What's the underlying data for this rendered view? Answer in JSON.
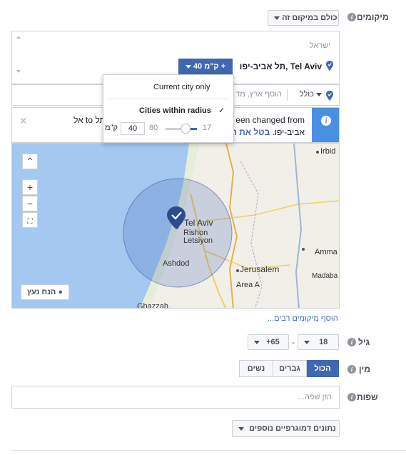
{
  "locations": {
    "label": "מיקומים",
    "scope_dropdown": "כולם במיקום זה",
    "country": "ישראל",
    "selected_city": "תל אביב-יפו, Tel Aviv",
    "radius_chip": "40 ק\"מ +",
    "include_dropdown": "כולל",
    "add_placeholder": "הוסף ארץ, מד",
    "notice": {
      "line1_left": "אל to תל",
      "line1_right": "een changed from",
      "line2_left": "אביב-יפו.",
      "line2_link": "בטל את הי"
    },
    "popup": {
      "option_current": "Current city only",
      "option_radius": "Cities within radius",
      "check": "✓",
      "slider_min": "17",
      "slider_max": "80",
      "radius_value": "40",
      "unit": "ק\"מ",
      "slider_fraction": 0.37
    },
    "map": {
      "labels": [
        "Tel Aviv",
        "Rishon",
        "Letsiyon",
        "Ashdod",
        "Jerusalem",
        "Area A",
        "Irbid",
        "Amma",
        "Madaba",
        "Ghazzah"
      ],
      "drop_pin_button": "הנח נעץ"
    },
    "add_bulk_link": "הוסף מיקומים רבים..."
  },
  "age": {
    "label": "גיל",
    "min": "18",
    "max": "+65",
    "separator": "-"
  },
  "gender": {
    "label": "מין",
    "options": [
      "הכול",
      "גברים",
      "נשים"
    ],
    "selected": "הכול"
  },
  "languages": {
    "label": "שפות",
    "placeholder": "הזן שפה..."
  },
  "more_demographics": "נתונים דמוגרפיים נוספים",
  "colors": {
    "accent": "#4267b2",
    "info_bar": "#4a90e2",
    "water": "#a4c8f0",
    "land": "#f2efe9"
  }
}
